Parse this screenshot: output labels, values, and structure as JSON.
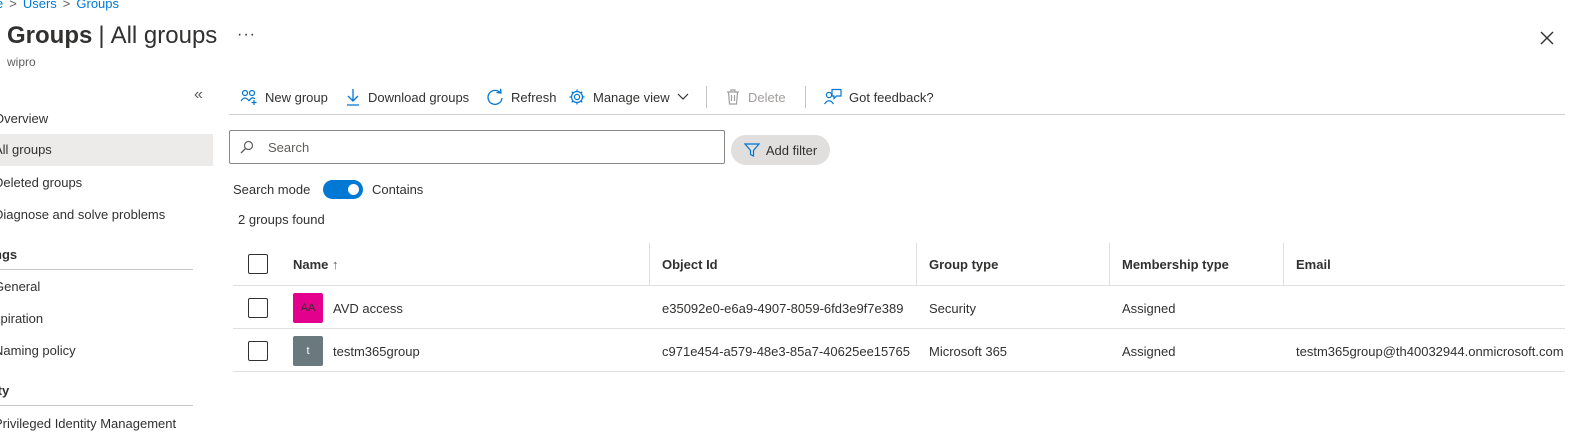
{
  "breadcrumb": {
    "home": "e",
    "users": "Users",
    "groups": "Groups"
  },
  "header": {
    "title_bold": "Groups",
    "title_separator": "|",
    "title_rest": "All groups",
    "subtitle": "wipro",
    "more": "···"
  },
  "sidebar": {
    "collapse": "«",
    "items": [
      {
        "label": "Overview"
      },
      {
        "label": "All groups"
      },
      {
        "label": "Deleted groups"
      },
      {
        "label": "Diagnose and solve problems"
      }
    ],
    "sections": [
      {
        "title": "ngs",
        "items": [
          "General",
          "xpiration",
          "Naming policy"
        ]
      },
      {
        "title": "ity",
        "items": [
          "Privileged Identity Management"
        ]
      }
    ]
  },
  "toolbar": {
    "new_group": "New group",
    "download_groups": "Download groups",
    "refresh": "Refresh",
    "manage_view": "Manage view",
    "delete": "Delete",
    "feedback": "Got feedback?"
  },
  "search": {
    "placeholder": "Search",
    "value": ""
  },
  "add_filter": "Add filter",
  "search_mode": {
    "label": "Search mode",
    "value": "Contains",
    "enabled": true
  },
  "results_count": "2 groups found",
  "table": {
    "columns": {
      "name": "Name",
      "sort_indicator": "↑",
      "object_id": "Object Id",
      "group_type": "Group type",
      "membership_type": "Membership type",
      "email": "Email"
    },
    "rows": [
      {
        "initials": "AA",
        "avatar_color": "#e3008c",
        "name": "AVD access",
        "object_id": "e35092e0-e6a9-4907-8059-6fd3e9f7e389",
        "group_type": "Security",
        "membership_type": "Assigned",
        "email": ""
      },
      {
        "initials": "t",
        "avatar_color": "#69797e",
        "name": "testm365group",
        "object_id": "c971e454-a579-48e3-85a7-40625ee15765",
        "group_type": "Microsoft 365",
        "membership_type": "Assigned",
        "email": "testm365group@th40032944.onmicrosoft.com"
      }
    ]
  },
  "colors": {
    "accent": "#0078d4",
    "selected_nav": "#edebe9",
    "disabled": "#a19f9d"
  }
}
